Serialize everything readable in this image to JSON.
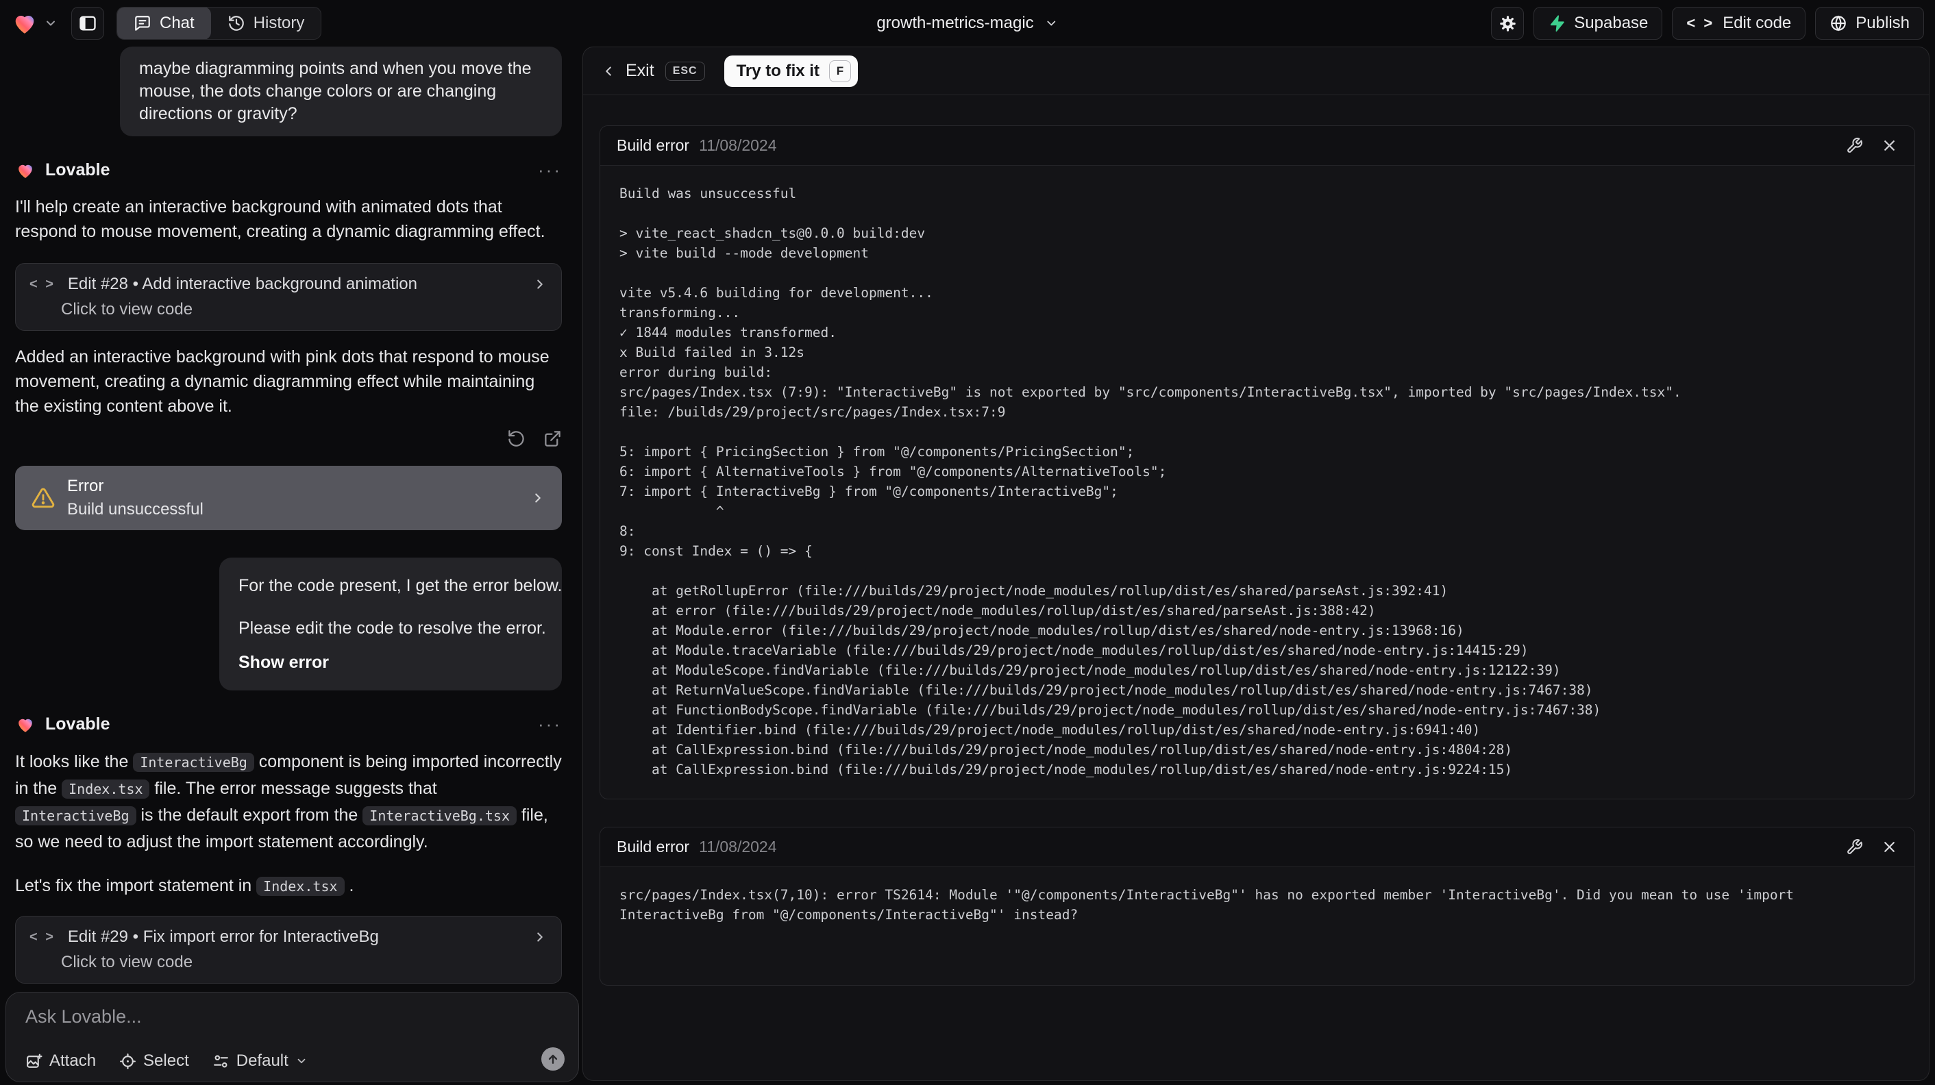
{
  "topbar": {
    "tab_chat": "Chat",
    "tab_history": "History",
    "project_name": "growth-metrics-magic",
    "supabase_label": "Supabase",
    "edit_code_label": "Edit code",
    "edit_code_glyph": "< >",
    "publish_label": "Publish"
  },
  "chat": {
    "assistant_name": "Lovable",
    "menu_dots": "···",
    "user_message_1": "maybe diagramming points and when you move the mouse, the dots change colors or are changing directions or gravity?",
    "message_1_intro": "I'll help create an interactive background with animated dots that respond to mouse movement, creating a dynamic diagramming effect.",
    "edit_28": {
      "icon_glyph": "< >",
      "title": "Edit #28 • Add interactive background animation",
      "subtitle": "Click to view code"
    },
    "message_1_summary": "Added an interactive background with pink dots that respond to mouse movement, creating a dynamic diagramming effect while maintaining the existing content above it.",
    "error_card": {
      "title": "Error",
      "subtitle": "Build unsuccessful"
    },
    "user_message_2": {
      "line_1": "For the code present, I get the error below.",
      "line_2": "Please edit the code to resolve the error.",
      "action": "Show error"
    },
    "message_2": {
      "p1_t1": "It looks like the ",
      "p1_c1": "InteractiveBg",
      "p1_t2": " component is being imported incorrectly in the ",
      "p1_c2": "Index.tsx",
      "p1_t3": " file. The error message suggests that ",
      "p1_c3": "InteractiveBg",
      "p1_t4": " is the default export from the ",
      "p1_c4": "InteractiveBg.tsx",
      "p1_t5": " file, so we need to adjust the import statement accordingly.",
      "p2_t1": "Let's fix the import statement in ",
      "p2_c1": "Index.tsx",
      "p2_t2": " ."
    },
    "edit_29": {
      "icon_glyph": "< >",
      "title": "Edit #29 • Fix import error for InteractiveBg",
      "subtitle": "Click to view code"
    },
    "input": {
      "placeholder": "Ask Lovable...",
      "attach_label": "Attach",
      "select_label": "Select",
      "mode_label": "Default"
    }
  },
  "fix_panel": {
    "exit_label": "Exit",
    "esc_key": "ESC",
    "fix_button_label": "Try to fix it",
    "fix_key": "F",
    "errors": [
      {
        "title": "Build error",
        "date": "11/08/2024",
        "console": "Build was unsuccessful\n\n> vite_react_shadcn_ts@0.0.0 build:dev\n> vite build --mode development\n\nvite v5.4.6 building for development...\ntransforming...\n✓ 1844 modules transformed.\nx Build failed in 3.12s\nerror during build:\nsrc/pages/Index.tsx (7:9): \"InteractiveBg\" is not exported by \"src/components/InteractiveBg.tsx\", imported by \"src/pages/Index.tsx\".\nfile: /builds/29/project/src/pages/Index.tsx:7:9\n\n5: import { PricingSection } from \"@/components/PricingSection\";\n6: import { AlternativeTools } from \"@/components/AlternativeTools\";\n7: import { InteractiveBg } from \"@/components/InteractiveBg\";\n            ^\n8:\n9: const Index = () => {\n\n    at getRollupError (file:///builds/29/project/node_modules/rollup/dist/es/shared/parseAst.js:392:41)\n    at error (file:///builds/29/project/node_modules/rollup/dist/es/shared/parseAst.js:388:42)\n    at Module.error (file:///builds/29/project/node_modules/rollup/dist/es/shared/node-entry.js:13968:16)\n    at Module.traceVariable (file:///builds/29/project/node_modules/rollup/dist/es/shared/node-entry.js:14415:29)\n    at ModuleScope.findVariable (file:///builds/29/project/node_modules/rollup/dist/es/shared/node-entry.js:12122:39)\n    at ReturnValueScope.findVariable (file:///builds/29/project/node_modules/rollup/dist/es/shared/node-entry.js:7467:38)\n    at FunctionBodyScope.findVariable (file:///builds/29/project/node_modules/rollup/dist/es/shared/node-entry.js:7467:38)\n    at Identifier.bind (file:///builds/29/project/node_modules/rollup/dist/es/shared/node-entry.js:6941:40)\n    at CallExpression.bind (file:///builds/29/project/node_modules/rollup/dist/es/shared/node-entry.js:4804:28)\n    at CallExpression.bind (file:///builds/29/project/node_modules/rollup/dist/es/shared/node-entry.js:9224:15)"
      },
      {
        "title": "Build error",
        "date": "11/08/2024",
        "console": "src/pages/Index.tsx(7,10): error TS2614: Module '\"@/components/InteractiveBg\"' has no exported member 'InteractiveBg'. Did you mean to use 'import InteractiveBg from \"@/components/InteractiveBg\"' instead?"
      }
    ]
  },
  "colors": {
    "supabase_green": "#3ecf8e",
    "warning_amber": "#e3b341",
    "error_card_bg": "#56565d",
    "page_bg": "#0b0b0d"
  }
}
